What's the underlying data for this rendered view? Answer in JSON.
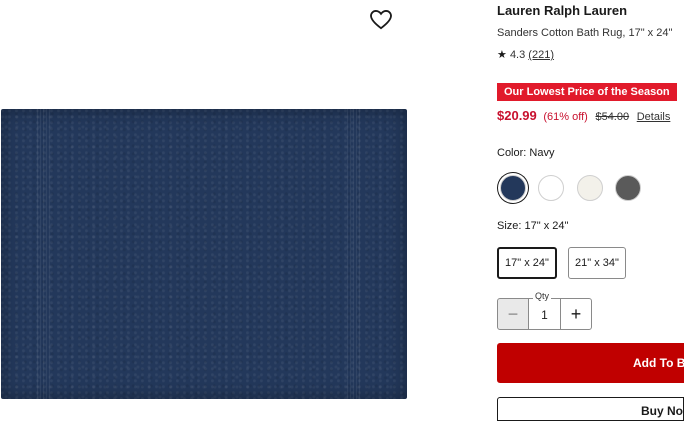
{
  "product": {
    "brand": "Lauren Ralph Lauren",
    "name": "Sanders Cotton Bath Rug, 17\" x 24\"",
    "rating": "4.3",
    "review_count": "(221)",
    "promo_badge": "Our Lowest Price of the Season",
    "sale_price": "$20.99",
    "discount": "(61% off)",
    "original_price": "$54.00",
    "details_link": "Details"
  },
  "color": {
    "label": "Color: Navy",
    "swatches": [
      {
        "name": "Navy",
        "hex": "#23385b"
      },
      {
        "name": "White",
        "hex": "#ffffff"
      },
      {
        "name": "Ivory",
        "hex": "#f3f1ea"
      },
      {
        "name": "Gray",
        "hex": "#5a5a5a"
      }
    ]
  },
  "size": {
    "label": "Size: 17\" x 24\"",
    "options": [
      "17\" x 24\"",
      "21\" x 34\""
    ]
  },
  "quantity": {
    "label": "Qty",
    "value": "1",
    "minus": "−",
    "plus": "+"
  },
  "actions": {
    "add_to_bag": "Add To Bag",
    "buy_now": "Buy Now"
  },
  "colors": {
    "accent_red": "#c8102e",
    "badge_red": "#e11a2b",
    "button_red": "#c00000",
    "rug_navy": "#23385b"
  }
}
